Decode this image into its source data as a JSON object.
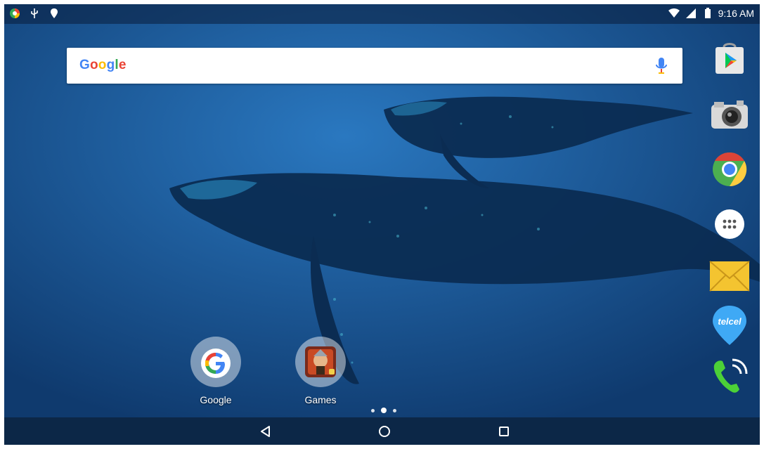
{
  "status_bar": {
    "time": "9:16 AM",
    "left_icons": [
      "app-notification-icon",
      "usb-icon",
      "location-pin-icon"
    ],
    "right_icons": [
      "wifi-icon",
      "cellular-signal-icon",
      "battery-icon"
    ]
  },
  "search": {
    "logo_text": "Google",
    "mic_icon": "mic-icon"
  },
  "shortcuts": [
    {
      "label": "Google",
      "icon": "google-g-icon"
    },
    {
      "label": "Games",
      "icon": "games-folder-icon"
    }
  ],
  "pager": {
    "pages": 3,
    "current": 2
  },
  "dock": [
    {
      "name": "Play Store",
      "icon": "play-store-icon"
    },
    {
      "name": "Camera",
      "icon": "camera-icon"
    },
    {
      "name": "Chrome",
      "icon": "chrome-icon"
    },
    {
      "name": "Apps",
      "icon": "app-drawer-icon"
    },
    {
      "name": "Email",
      "icon": "email-icon"
    },
    {
      "name": "Telcel",
      "icon": "telcel-icon",
      "text": "telcel"
    },
    {
      "name": "Phone",
      "icon": "phone-icon"
    }
  ],
  "navbar": {
    "icons": [
      "back-icon",
      "home-icon",
      "recents-icon"
    ]
  },
  "colors": {
    "wallpaper_blue": "#174f8d",
    "navbar": "#0c2747",
    "google_blue": "#4285F4",
    "google_red": "#EA4335",
    "google_yellow": "#FBBC05",
    "google_green": "#34A853"
  }
}
